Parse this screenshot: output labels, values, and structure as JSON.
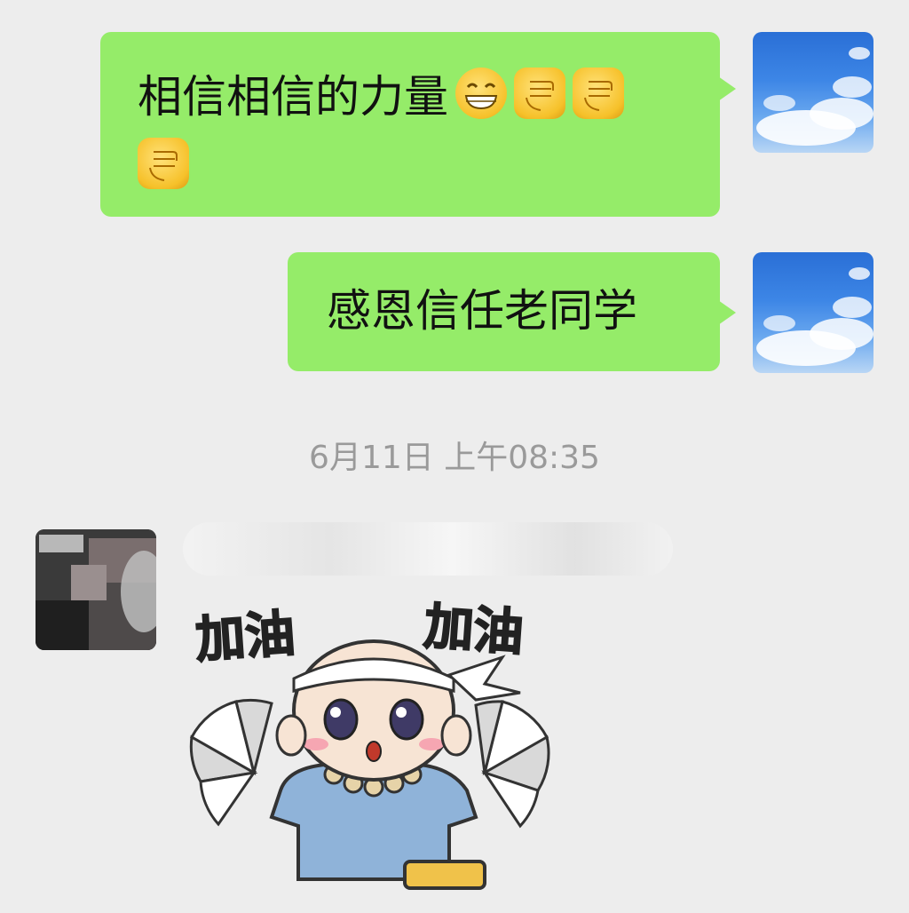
{
  "messages": [
    {
      "side": "right",
      "text": "相信相信的力量",
      "emojis": [
        "grin-emoji",
        "raised-fist-emoji",
        "raised-fist-emoji",
        "raised-fist-emoji"
      ]
    },
    {
      "side": "right",
      "text": "感恩信任老同学"
    }
  ],
  "timestamp": "6月11日 上午08:35",
  "peer_message": {
    "sender_name_obscured": true,
    "sticker": {
      "caption_left": "加油",
      "caption_right": "加油"
    }
  },
  "colors": {
    "background": "#ededed",
    "own_bubble": "#95ec69",
    "timestamp_text": "#9a9a9a"
  }
}
